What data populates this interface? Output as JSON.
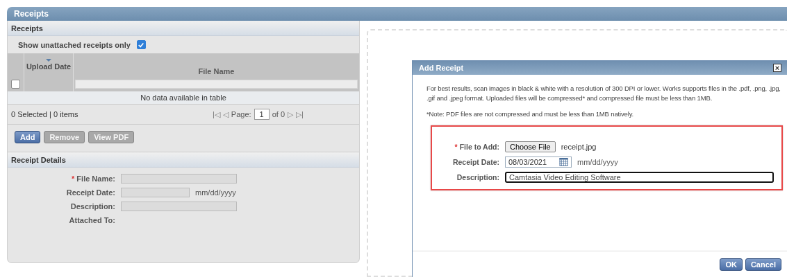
{
  "page_title": "Receipts",
  "receipts": {
    "title": "Receipts",
    "filter": {
      "label": "Show unattached receipts only",
      "checked": true
    },
    "table": {
      "select_all_checked": false,
      "columns": [
        {
          "label": "Upload Date",
          "sorted": true
        },
        {
          "label": "File Name",
          "sorted": false
        }
      ],
      "empty_text": "No data available in table"
    },
    "footer": {
      "summary": "0 Selected | 0 items",
      "first": "|◁",
      "prev": "◁",
      "page_label": "Page:",
      "page": "1",
      "of": "of 0",
      "next": "▷",
      "last": "▷|"
    },
    "buttons": [
      {
        "label": "Add",
        "disabled": false
      },
      {
        "label": "Remove",
        "disabled": true
      },
      {
        "label": "View PDF",
        "disabled": true
      }
    ]
  },
  "details": {
    "title": "Receipt Details",
    "fields": [
      {
        "label": "File Name:",
        "required_mark": "*",
        "kind": "text"
      },
      {
        "label": "Receipt Date:",
        "kind": "date",
        "hint": "mm/dd/yyyy"
      },
      {
        "label": "Description:",
        "kind": "text"
      },
      {
        "label": "Attached To:",
        "kind": "none"
      }
    ]
  },
  "dialog": {
    "title": "Add Receipt",
    "close": "×",
    "info": "For best results, scan images in black & white with a resolution of 300 DPI or lower. Works supports files in the .pdf, .png, .jpg, .gif and .jpeg format. Uploaded files will be compressed* and compressed file must be less than 1MB.",
    "note": "*Note: PDF files are not compressed and must be less than 1MB natively.",
    "fields": [
      {
        "label": "File to Add:",
        "required_mark": "*",
        "kind": "file",
        "button": "Choose File",
        "value": "receipt.jpg"
      },
      {
        "label": "Receipt Date:",
        "kind": "date",
        "value": "08/03/2021",
        "hint": "mm/dd/yyyy"
      },
      {
        "label": "Description:",
        "kind": "text",
        "value": "Camtasia Video Editing Software"
      }
    ],
    "buttons": [
      "OK",
      "Cancel"
    ]
  }
}
